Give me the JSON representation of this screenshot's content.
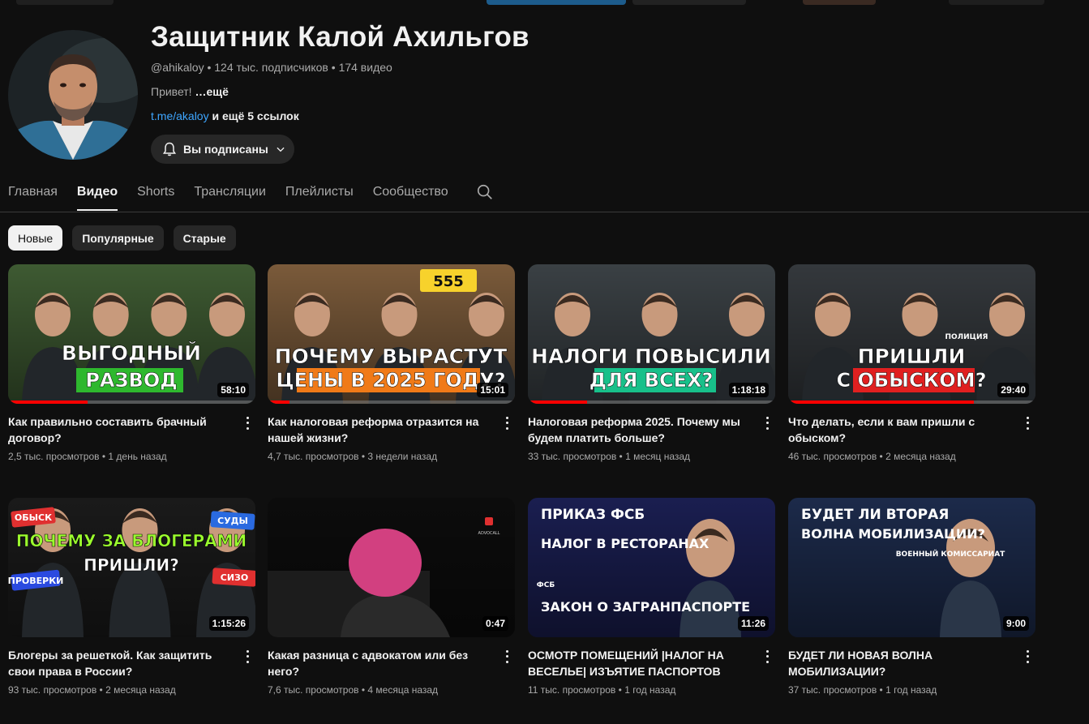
{
  "channel": {
    "name": "Защитник Калой Ахильгов",
    "handle": "@ahikaloy",
    "subscribers": "124 тыс. подписчиков",
    "videos_count": "174 видео",
    "meta_sep": " • ",
    "description": "Привет!",
    "more_label": " …ещё",
    "link_text": "t.me/akaloy",
    "more_links": " и ещё 5 ссылок",
    "subscribe_label": "Вы подписаны"
  },
  "tabs": [
    {
      "label": "Главная"
    },
    {
      "label": "Видео",
      "active": true
    },
    {
      "label": "Shorts"
    },
    {
      "label": "Трансляции"
    },
    {
      "label": "Плейлисты"
    },
    {
      "label": "Сообщество"
    }
  ],
  "chips": [
    {
      "label": "Новые",
      "active": true
    },
    {
      "label": "Популярные"
    },
    {
      "label": "Старые"
    }
  ],
  "meta_sep": " • ",
  "videos": [
    {
      "title": "Как правильно составить брачный договор?",
      "views": "2,5 тыс. просмотров",
      "age": "1 день назад",
      "duration": "58:10",
      "progress": 0.32,
      "thumb": {
        "line1": "ВЫГОДНЫЙ",
        "line2": "РАЗВОД",
        "bg": "#3e5a32",
        "accent": "#2eb82e"
      }
    },
    {
      "title": "Как налоговая реформа отразится на нашей жизни?",
      "views": "4,7 тыс. просмотров",
      "age": "3 недели назад",
      "duration": "15:01",
      "progress": 0.09,
      "thumb": {
        "line1": "ПОЧЕМУ ВЫРАСТУТ",
        "line2": "ЦЕНЫ В 2025 ГОДУ?",
        "bg": "#7a5a3a",
        "accent": "#f07a18",
        "badge": "555"
      }
    },
    {
      "title": "Налоговая реформа 2025. Почему мы будем платить больше?",
      "views": "33 тыс. просмотров",
      "age": "1 месяц назад",
      "duration": "1:18:18",
      "progress": 0.24,
      "thumb": {
        "line1": "НАЛОГИ ПОВЫСИЛИ",
        "line2": "ДЛЯ ВСЕХ?",
        "bg": "#3a4044",
        "accent": "#18c08a"
      }
    },
    {
      "title": "Что делать, если к вам пришли с обыском?",
      "views": "46 тыс. просмотров",
      "age": "2 месяца назад",
      "duration": "29:40",
      "progress": 0.75,
      "thumb": {
        "line1": "ПРИШЛИ",
        "line2": "С ОБЫСКОМ?",
        "bg": "#34383c",
        "accent": "#e02020",
        "badge": "ПОЛИЦИЯ"
      }
    },
    {
      "title": "Блогеры за решеткой. Как защитить свои права в России?",
      "views": "93 тыс. просмотров",
      "age": "2 месяца назад",
      "duration": "1:15:26",
      "progress": 0.0,
      "thumb": {
        "line1": "ПОЧЕМУ ЗА БЛОГЕРАМИ",
        "line2": "ПРИШЛИ?",
        "bg": "#1a1a1a",
        "accent": "#9cff2e",
        "tags": [
          "ОБЫСК",
          "СУДЫ",
          "ПРОВЕРКИ",
          "СИЗО"
        ]
      }
    },
    {
      "title": "Какая разница с адвокатом или без него?",
      "views": "7,6 тыс. просмотров",
      "age": "4 месяца назад",
      "duration": "0:47",
      "progress": 0.0,
      "thumb": {
        "line1": "",
        "line2": "",
        "bg": "#0c0c0c",
        "accent": "#d24080",
        "logo": "ADVOCALL"
      }
    },
    {
      "title": "ОСМОТР ПОМЕЩЕНИЙ |НАЛОГ НА ВЕСЕЛЬЕ| ИЗЪЯТИЕ ПАСПОРТОВ",
      "views": "11 тыс. просмотров",
      "age": "1 год назад",
      "duration": "11:26",
      "progress": 0.0,
      "thumb": {
        "line1": "ПРИКАЗ ФСБ",
        "line2": "НАЛОГ В РЕСТОРАНАХ",
        "line3": "ЗАКОН О ЗАГРАНПАСПОРТЕ",
        "bg": "#1a1e50",
        "accent": "#ffffff",
        "badge": "ФСБ"
      }
    },
    {
      "title": "БУДЕТ ЛИ НОВАЯ ВОЛНА МОБИЛИЗАЦИИ?",
      "views": "37 тыс. просмотров",
      "age": "1 год назад",
      "duration": "9:00",
      "progress": 0.0,
      "thumb": {
        "line1": "БУДЕТ ЛИ ВТОРАЯ",
        "line2": "ВОЛНА МОБИЛИЗАЦИИ?",
        "bg": "#1c2a4a",
        "accent": "#ffffff",
        "badge": "ВОЕННЫЙ КОМИССАРИАТ"
      }
    }
  ],
  "icons": {
    "bell": "bell-icon",
    "chevron": "chevron-down-icon",
    "search": "search-icon",
    "more": "more-vertical-icon"
  }
}
